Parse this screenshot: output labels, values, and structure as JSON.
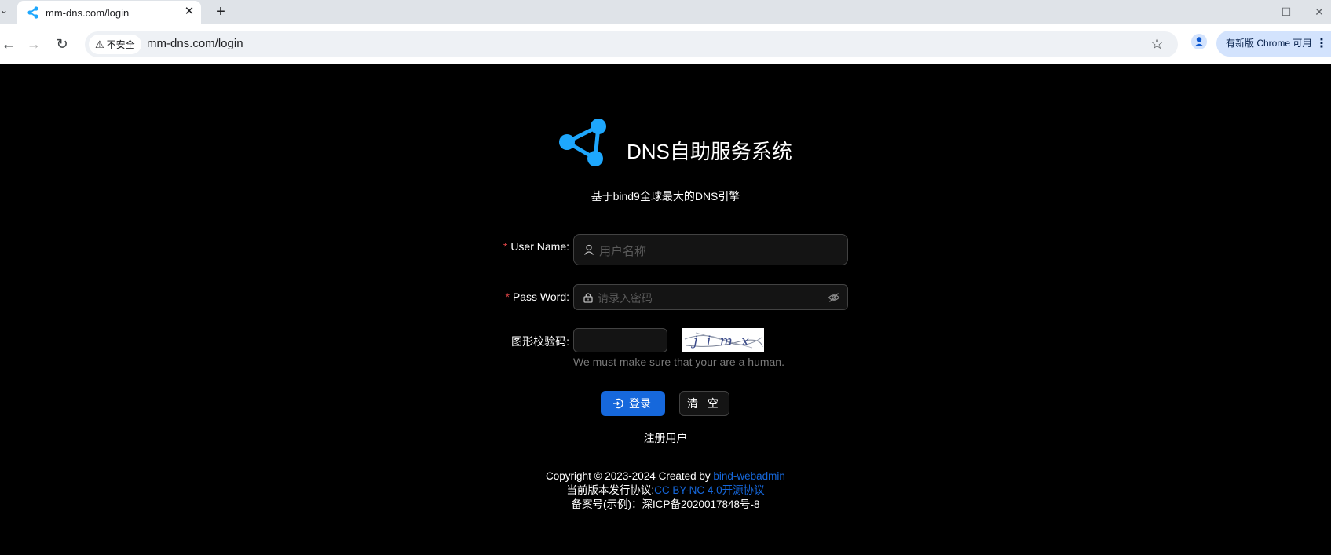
{
  "browser": {
    "tab_title": "mm-dns.com/login",
    "security_label": "不安全",
    "url": "mm-dns.com/login",
    "update_label": "有新版 Chrome 可用"
  },
  "header": {
    "title": "DNS自助服务系统",
    "subtitle": "基于bind9全球最大的DNS引擎"
  },
  "form": {
    "username_label": "User Name",
    "username_placeholder": "用户名称",
    "password_label": "Pass Word",
    "password_placeholder": "请录入密码",
    "captcha_label": "图形校验码",
    "captcha_value": "",
    "captcha_text": "j i m x",
    "captcha_hint": "We must make sure that your are a human.",
    "login_button": "登录",
    "clear_button": "清 空",
    "register_link": "注册用户"
  },
  "footer": {
    "copyright_prefix": "Copyright © 2023-2024 Created by ",
    "copyright_link": "bind-webadmin",
    "license_prefix": "当前版本发行协议:",
    "license_link": "CC BY-NC 4.0开源协议",
    "icp": "备案号(示例)：深ICP备2020017848号-8"
  },
  "colors": {
    "primary": "#1668dc",
    "logo": "#1ea7fd",
    "required": "#dc4446",
    "background": "#000000"
  }
}
